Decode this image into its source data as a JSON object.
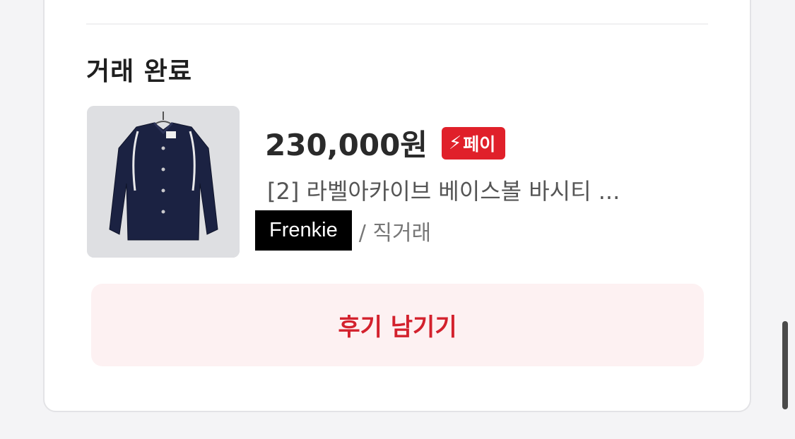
{
  "section": {
    "title": "거래 완료"
  },
  "product": {
    "price": "230,000원",
    "pay_badge": "페이",
    "pay_icon": "lightning-icon",
    "title": "[2] 라벨아카이브 베이스볼 바시티 ...",
    "seller": "Frenkie",
    "deal_type": "/ 직거래",
    "thumbnail": "navy varsity jacket photo"
  },
  "actions": {
    "review_label": "후기 남기기"
  },
  "colors": {
    "accent": "#e0202a",
    "button_bg": "#fdf1f2",
    "button_text": "#d3212d"
  }
}
